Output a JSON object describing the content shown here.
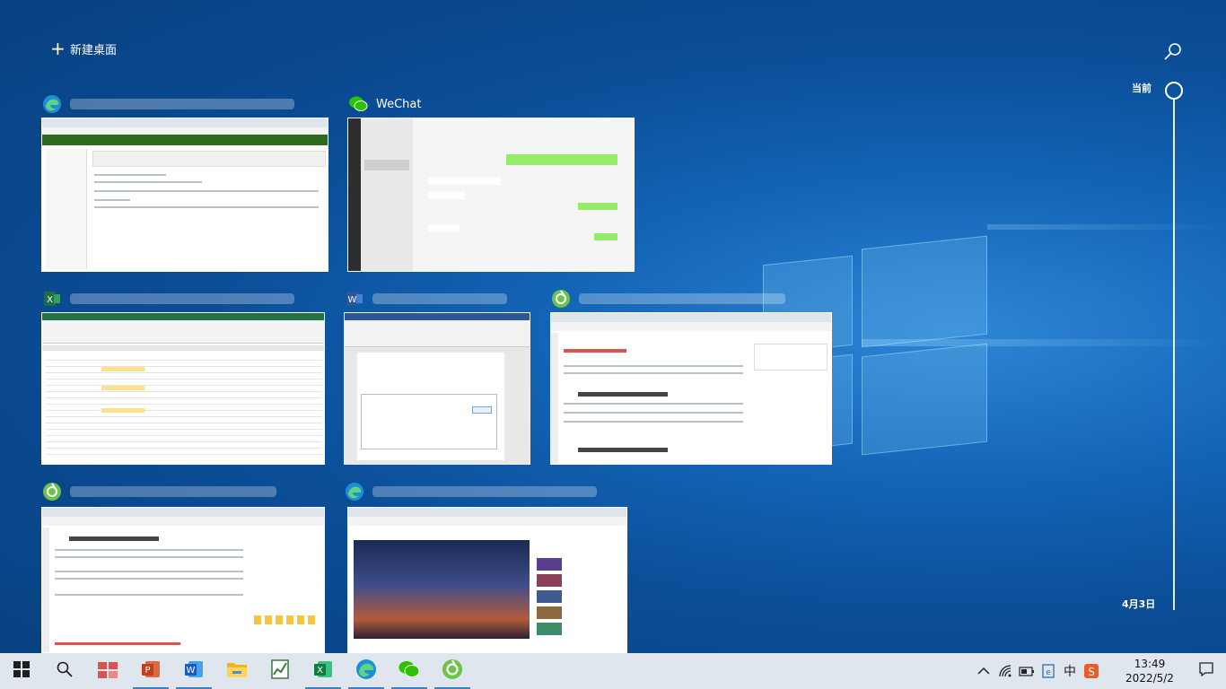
{
  "top": {
    "new_desktop_label": "新建桌面"
  },
  "timeline": {
    "current_label": "当前",
    "date_label": "4月3日"
  },
  "windows": [
    {
      "app": "edge",
      "title": ""
    },
    {
      "app": "wechat",
      "title": "WeChat"
    },
    {
      "app": "excel",
      "title": ""
    },
    {
      "app": "word",
      "title": ""
    },
    {
      "app": "browser",
      "title": ""
    },
    {
      "app": "browser",
      "title": ""
    },
    {
      "app": "edge",
      "title": ""
    }
  ],
  "taskbar": {
    "apps": [
      "start-icon",
      "search-icon",
      "remote-icon",
      "powerpoint-icon",
      "word-icon",
      "file-explorer-icon",
      "chart-app-icon",
      "excel-icon",
      "edge-icon",
      "wechat-icon",
      "browser-icon"
    ],
    "tray": {
      "ime": "中",
      "time": "13:49",
      "date": "2022/5/2"
    }
  },
  "colors": {
    "taskbar_bg": "#dfe6ee",
    "desktop_bg": "#0b4e98",
    "accent": "#3b7fc4"
  }
}
